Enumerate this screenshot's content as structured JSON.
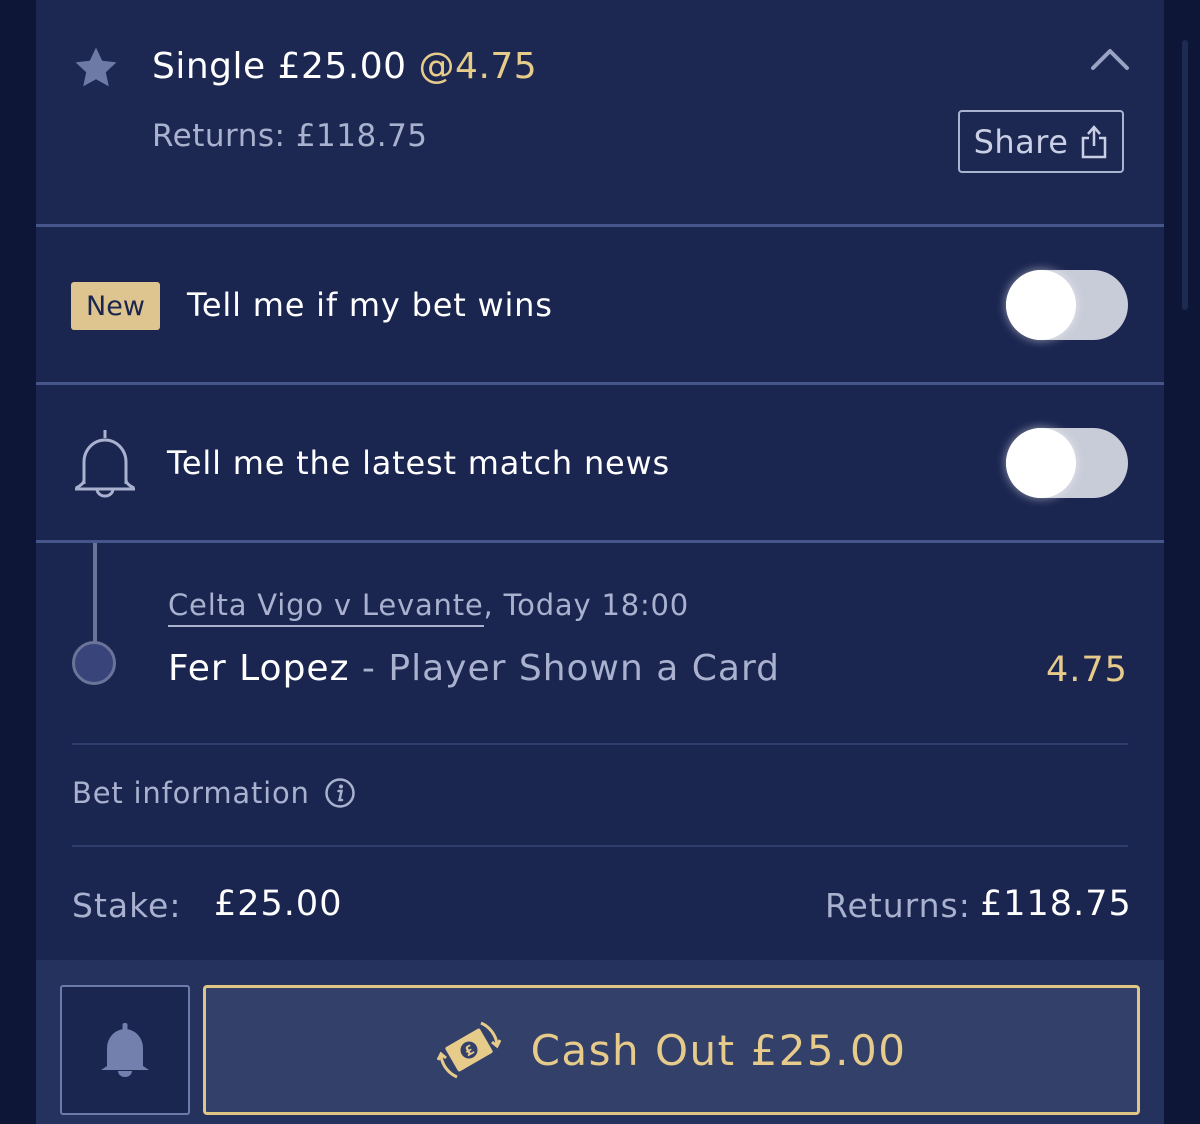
{
  "bet": {
    "type_label": "Single £25.00",
    "odds_label": "@4.75",
    "returns_label": "Returns: £118.75",
    "share_label": "Share"
  },
  "notifications": {
    "badge_new": "New",
    "bet_wins_label": "Tell me if my bet wins",
    "bet_wins_enabled": false,
    "match_news_label": "Tell me the latest match news",
    "match_news_enabled": false
  },
  "selection": {
    "event_link": "Celta Vigo v Levante",
    "event_time": ", Today 18:00",
    "player": "Fer Lopez",
    "separator": " - ",
    "market": "Player Shown a Card",
    "odds": "4.75"
  },
  "bet_info": {
    "label": "Bet information",
    "stake_label": "Stake:",
    "stake_value": "£25.00",
    "returns_label": "Returns:",
    "returns_value": "£118.75"
  },
  "footer": {
    "cashout_label": "Cash Out £25.00"
  },
  "icons": {
    "star": "star-icon",
    "chevron": "chevron-up-icon",
    "share": "share-icon",
    "bell": "bell-icon",
    "info": "info-icon",
    "cashout": "cash-out-icon"
  },
  "colors": {
    "background": "#1a2550",
    "accent_gold": "#e7cb8a",
    "muted_text": "#a9b1cf"
  }
}
